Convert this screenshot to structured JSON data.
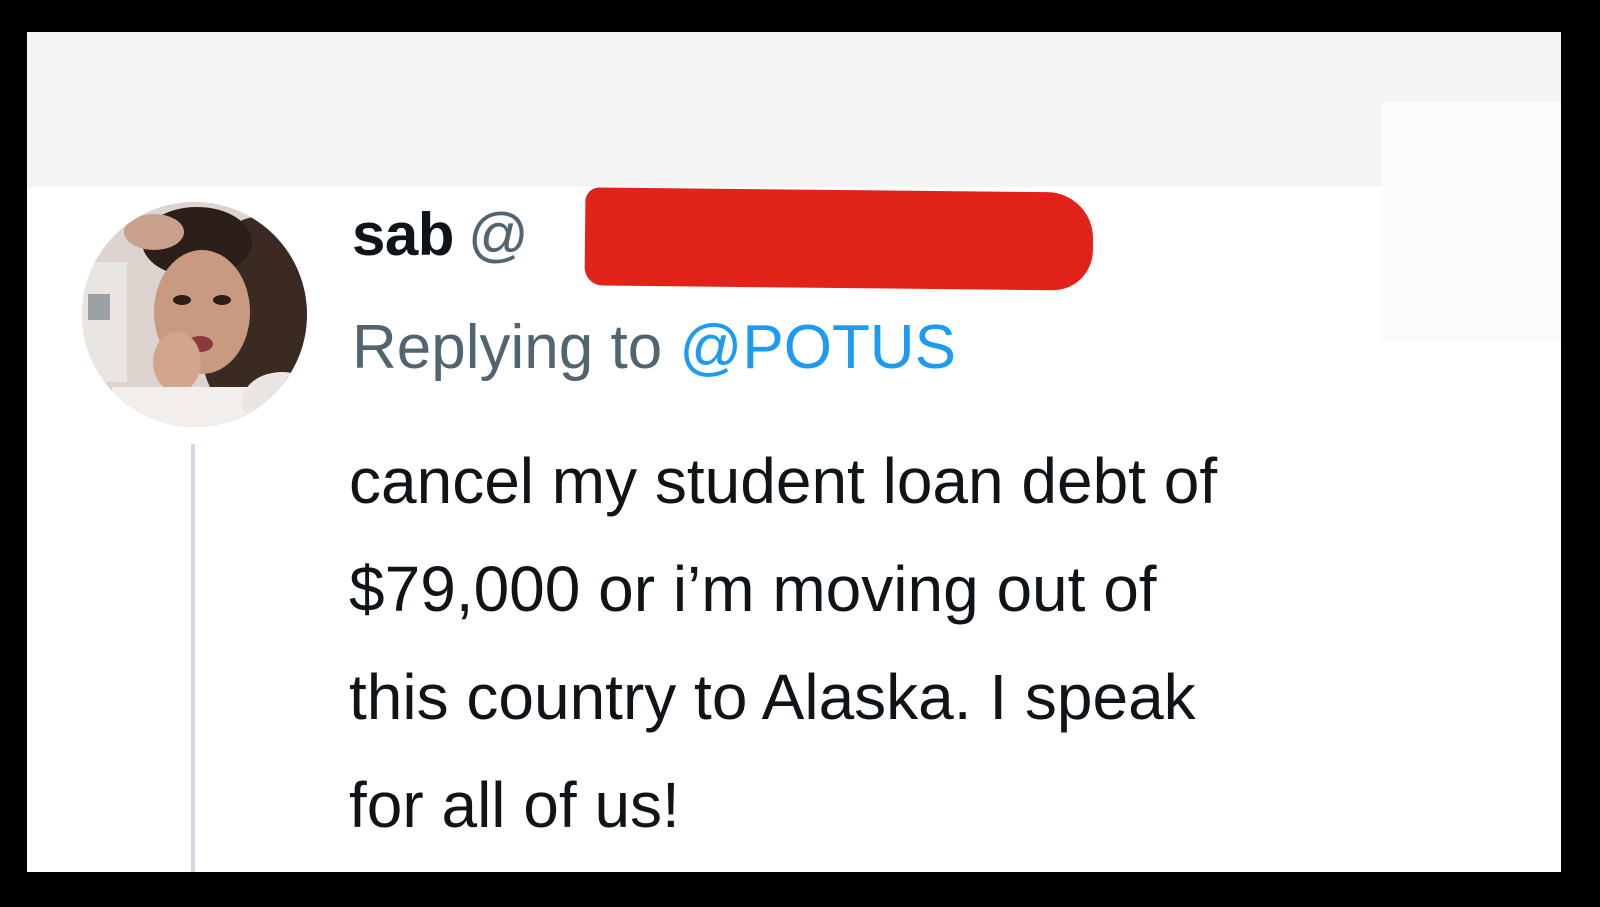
{
  "tweet": {
    "display_name": "sab",
    "handle_visible": "@",
    "handle_redacted": true,
    "reply_prefix": "Replying to",
    "reply_mention": "@POTUS",
    "text": "cancel my student loan debt of\n$79,000 or i’m moving out of\nthis country to Alaska. I speak\nfor all of us!"
  },
  "colors": {
    "name": "#0f1419",
    "secondary": "#536471",
    "mention": "#1d9bf0",
    "redaction": "#e2231a",
    "thread_line": "#cfd9de",
    "border": "#000000"
  },
  "icons": {
    "avatar": "user-avatar-photo"
  }
}
